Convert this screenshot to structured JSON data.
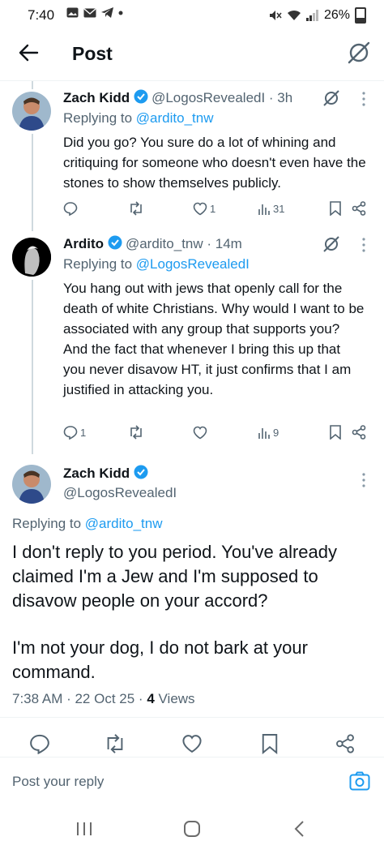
{
  "status_bar": {
    "time": "7:40",
    "battery": "26%"
  },
  "header": {
    "title": "Post"
  },
  "tweets": [
    {
      "name": "Zach Kidd",
      "handle": "@LogosRevealedI · 3h",
      "reply_prefix": "Replying to ",
      "reply_to": "@ardito_tnw",
      "body": "Did you go? You sure do a lot of whining and critiquing for someone who doesn't even have the stones to show themselves publicly.",
      "replies": "",
      "retweets": "",
      "likes": "1",
      "views": "31"
    },
    {
      "name": "Ardito",
      "handle": "@ardito_tnw · 14m",
      "reply_prefix": "Replying to ",
      "reply_to": "@LogosRevealedI",
      "body": "You hang out with jews that openly call for the death of white Christians. Why would I want to be associated with any group that supports you? And the fact that whenever I bring this up that you never disavow HT, it just confirms that I am justified in attacking you.",
      "replies": "1",
      "retweets": "",
      "likes": "",
      "views": "9"
    }
  ],
  "main_post": {
    "name": "Zach Kidd",
    "handle": "@LogosRevealedI",
    "reply_prefix": "Replying to ",
    "reply_to": "@ardito_tnw",
    "body_p1": "I don't reply to you period. You've already claimed I'm a Jew and I'm supposed to disavow people on your accord?",
    "body_p2": "I'm not your dog, I do not bark at your command.",
    "time": "7:38 AM · 22 Oct 25 · ",
    "views_count": "4",
    "views_label": " Views"
  },
  "reply_box": {
    "placeholder": "Post your reply"
  },
  "colors": {
    "accent": "#1d9bf0",
    "verified": "#1d9bf0",
    "muted": "#536471"
  }
}
